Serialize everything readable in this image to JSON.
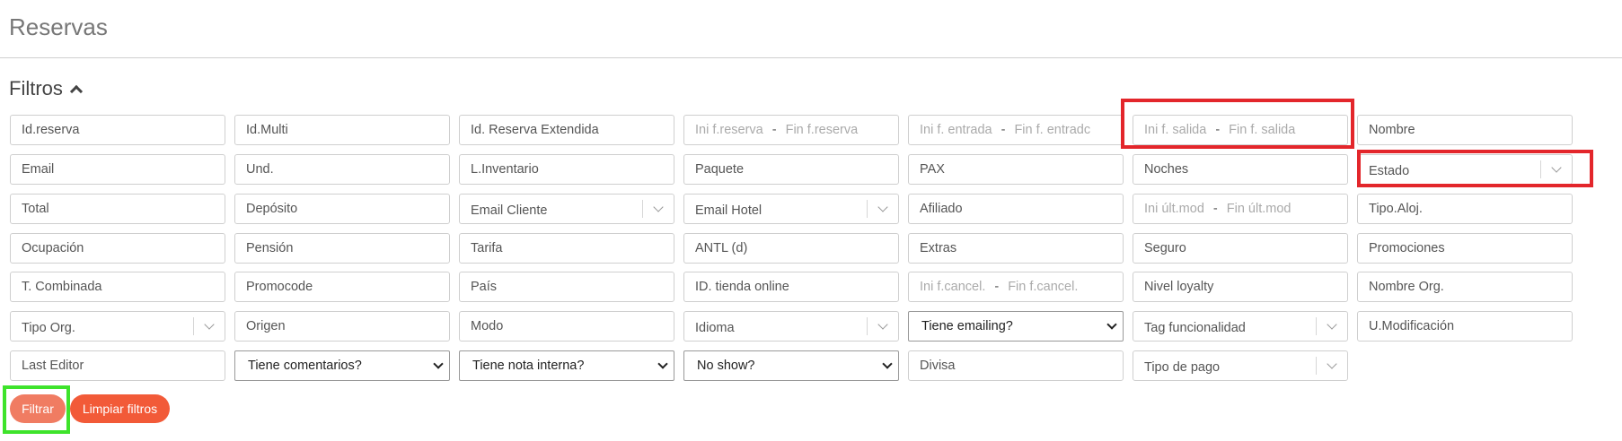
{
  "page": {
    "title": "Reservas"
  },
  "filters": {
    "heading": "Filtros",
    "rows": [
      [
        {
          "kind": "input",
          "placeholder": "Id.reserva"
        },
        {
          "kind": "input",
          "placeholder": "Id.Multi"
        },
        {
          "kind": "input",
          "placeholder": "Id. Reserva Extendida"
        },
        {
          "kind": "range",
          "from": "Ini f.reserva",
          "to": "Fin f.reserva"
        },
        {
          "kind": "range",
          "from": "Ini f. entrada",
          "to": "Fin f. entradc"
        },
        {
          "kind": "range",
          "from": "Ini f. salida",
          "to": "Fin f. salida"
        },
        {
          "kind": "input",
          "placeholder": "Nombre"
        }
      ],
      [
        {
          "kind": "input",
          "placeholder": "Email"
        },
        {
          "kind": "input",
          "placeholder": "Und."
        },
        {
          "kind": "input",
          "placeholder": "L.Inventario"
        },
        {
          "kind": "input",
          "placeholder": "Paquete"
        },
        {
          "kind": "input",
          "placeholder": "PAX"
        },
        {
          "kind": "input",
          "placeholder": "Noches"
        },
        {
          "kind": "combo",
          "placeholder": "Estado"
        }
      ],
      [
        {
          "kind": "input",
          "placeholder": "Total"
        },
        {
          "kind": "input",
          "placeholder": "Depósito"
        },
        {
          "kind": "combo",
          "placeholder": "Email Cliente"
        },
        {
          "kind": "combo",
          "placeholder": "Email Hotel"
        },
        {
          "kind": "input",
          "placeholder": "Afiliado"
        },
        {
          "kind": "range",
          "from": "Ini últ.mod",
          "to": "Fin últ.mod"
        },
        {
          "kind": "input",
          "placeholder": "Tipo.Aloj."
        }
      ],
      [
        {
          "kind": "input",
          "placeholder": "Ocupación"
        },
        {
          "kind": "input",
          "placeholder": "Pensión"
        },
        {
          "kind": "input",
          "placeholder": "Tarifa"
        },
        {
          "kind": "input",
          "placeholder": "ANTL (d)"
        },
        {
          "kind": "input",
          "placeholder": "Extras"
        },
        {
          "kind": "input",
          "placeholder": "Seguro"
        },
        {
          "kind": "input",
          "placeholder": "Promociones"
        }
      ],
      [
        {
          "kind": "input",
          "placeholder": "T. Combinada"
        },
        {
          "kind": "input",
          "placeholder": "Promocode"
        },
        {
          "kind": "input",
          "placeholder": "País"
        },
        {
          "kind": "input",
          "placeholder": "ID. tienda online"
        },
        {
          "kind": "range",
          "from": "Ini f.cancel.",
          "to": "Fin f.cancel."
        },
        {
          "kind": "input",
          "placeholder": "Nivel loyalty"
        },
        {
          "kind": "input",
          "placeholder": "Nombre Org."
        }
      ],
      [
        {
          "kind": "combo",
          "placeholder": "Tipo Org."
        },
        {
          "kind": "input",
          "placeholder": "Origen"
        },
        {
          "kind": "input",
          "placeholder": "Modo"
        },
        {
          "kind": "combo",
          "placeholder": "Idioma"
        },
        {
          "kind": "select",
          "value": "Tiene emailing?"
        },
        {
          "kind": "combo",
          "placeholder": "Tag funcionalidad"
        },
        {
          "kind": "input",
          "placeholder": "U.Modificación"
        }
      ],
      [
        {
          "kind": "input",
          "placeholder": "Last Editor"
        },
        {
          "kind": "select",
          "value": "Tiene comentarios?"
        },
        {
          "kind": "select",
          "value": "Tiene nota interna?"
        },
        {
          "kind": "select",
          "value": "No show?"
        },
        {
          "kind": "input",
          "placeholder": "Divisa"
        },
        {
          "kind": "combo",
          "placeholder": "Tipo de pago"
        }
      ]
    ]
  },
  "actions": {
    "filter_label": "Filtrar",
    "clear_label": "Limpiar filtros"
  },
  "colors": {
    "highlight_red": "#e3262b",
    "highlight_green": "#3ee32b",
    "button_primary": "#f07c62",
    "button_secondary": "#f25a38"
  }
}
